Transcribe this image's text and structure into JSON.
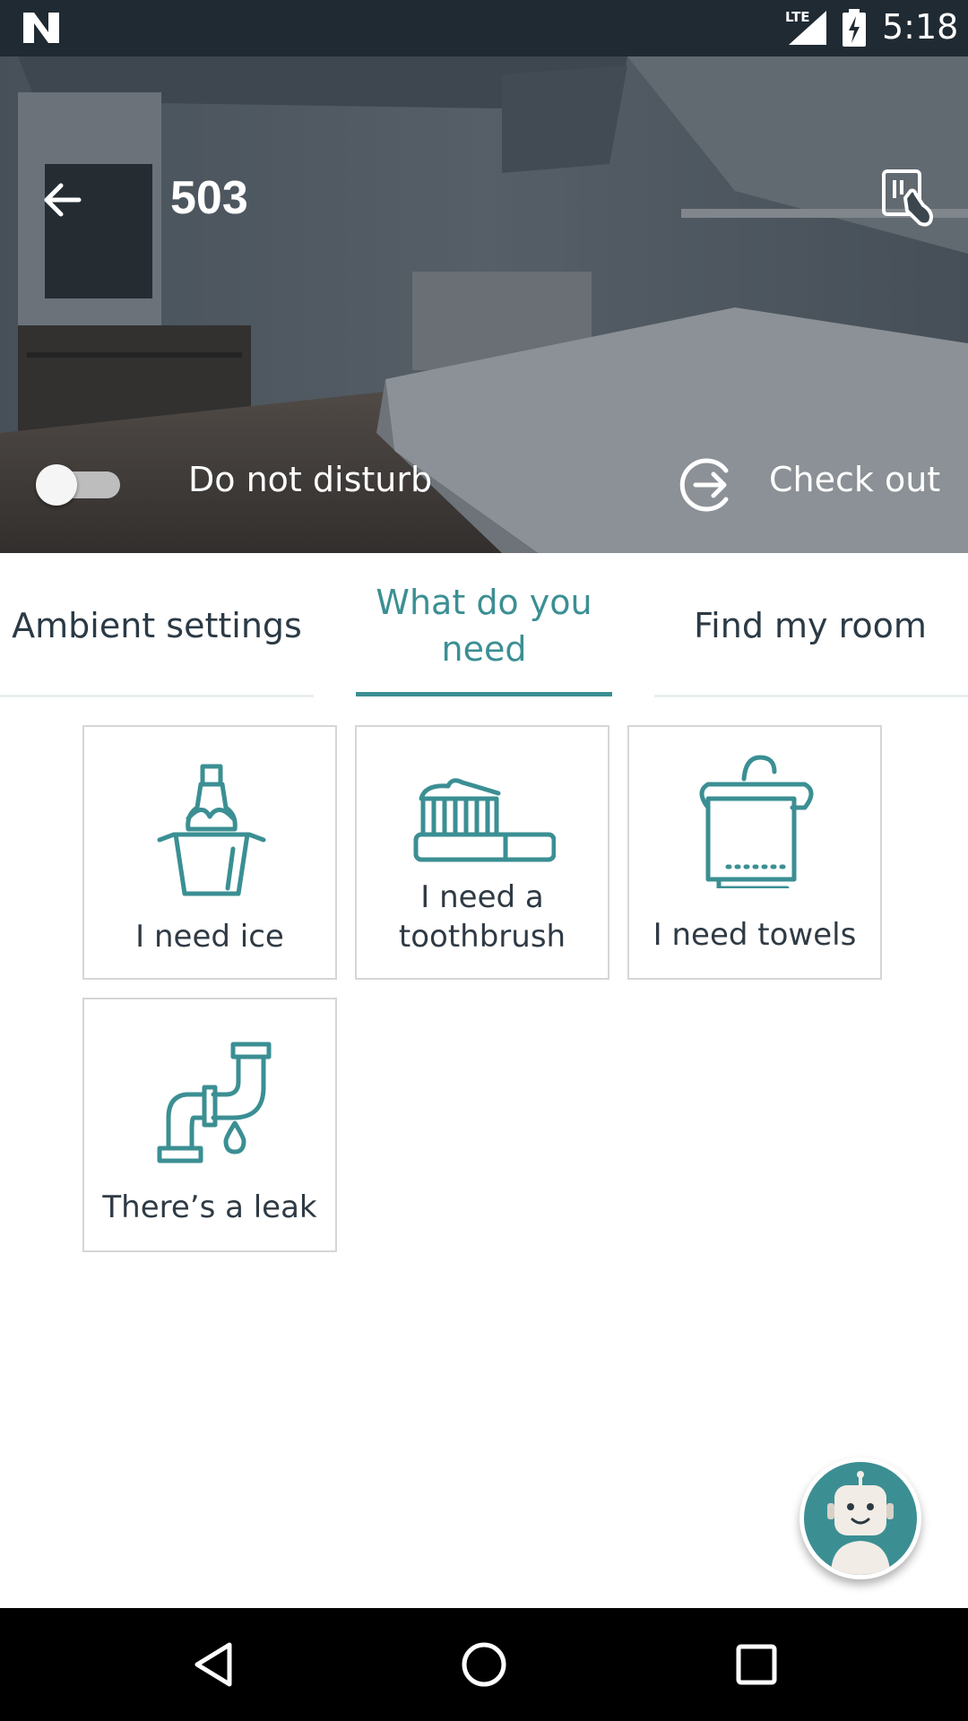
{
  "status_bar": {
    "network": "LTE",
    "time": "5:18"
  },
  "header": {
    "room_number": "503",
    "dnd_label": "Do not disturb",
    "dnd_on": false,
    "checkout_label": "Check out"
  },
  "tabs": [
    {
      "label": "Ambient settings",
      "active": false
    },
    {
      "label": "What do you need",
      "active": true
    },
    {
      "label": "Find my room",
      "active": false
    }
  ],
  "requests": [
    {
      "label": "I need ice",
      "icon": "ice-bucket-icon"
    },
    {
      "label": "I need a toothbrush",
      "icon": "toothbrush-icon"
    },
    {
      "label": "I need towels",
      "icon": "towels-icon"
    },
    {
      "label": "There’s a leak",
      "icon": "leak-pipe-icon"
    }
  ],
  "colors": {
    "accent": "#3b8f93",
    "status_bar": "#1f2a33",
    "text_dark": "#2b3a45"
  }
}
